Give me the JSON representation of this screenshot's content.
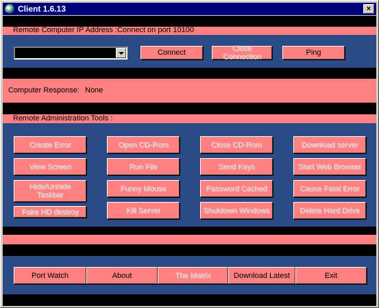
{
  "window": {
    "title": "Client 1.6.13",
    "close_glyph": "×"
  },
  "connection": {
    "header": "Remote Computer IP Address :Connect on port 10100",
    "ip_value": "",
    "connect_label": "Connect",
    "close_connection_label": "Close Connection",
    "ping_label": "Ping"
  },
  "response": {
    "label": "Computer Response:",
    "value": "None"
  },
  "tools": {
    "header": "Remote Administration Tools :",
    "create_error": "Create Error",
    "view_screen": "View Screen",
    "hide_taskbar_1": "Hide/Unhide",
    "hide_taskbar_2": "Taskbar",
    "fake_hd_destroy": "Fake HD destroy",
    "open_cdrom": "Open CD-Rom",
    "run_file": "Run File",
    "funny_mouse": "Funny Mouse",
    "kill_server": "Kill Server",
    "close_cdrom": "Close CD-Rom",
    "send_keys": "Send Keys",
    "password_cached": "Password Cached",
    "shutdown_windows": "Shutdown Windows",
    "download_server": "Download server",
    "start_web_browser": "Start Web Browser",
    "cause_fatal_error": "Cause Fatal Error",
    "delete_hard_drive": "Delete Hard Drive"
  },
  "bottom": {
    "port_watch": "Port Watch",
    "about": "About",
    "the_matrix": "The Matrix",
    "download_latest": "Download Latest",
    "exit": "Exit"
  },
  "colors": {
    "accent": "#ff8080",
    "panel": "#2a4b85",
    "titlebar": "#00007b"
  }
}
